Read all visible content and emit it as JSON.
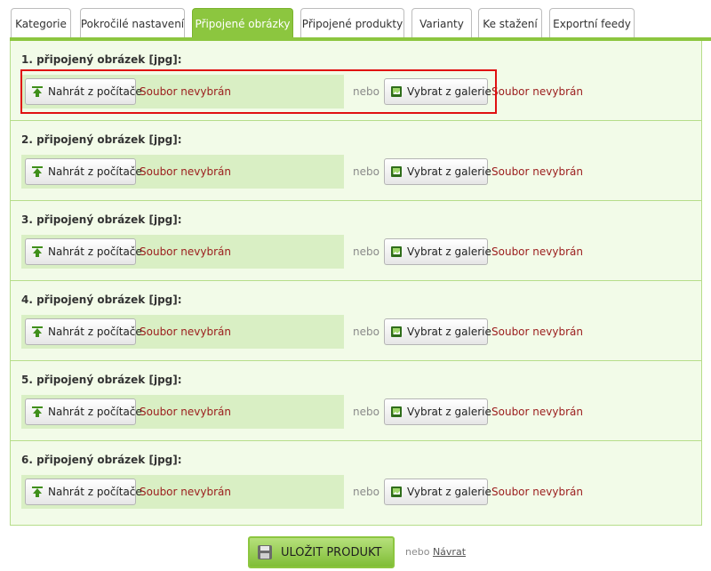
{
  "tabs": [
    {
      "label": "Kategorie",
      "active": false
    },
    {
      "label": "Pokročilé nastavení",
      "active": false
    },
    {
      "label": "Připojené obrázky",
      "active": true
    },
    {
      "label": "Připojené produkty",
      "active": false
    },
    {
      "label": "Varianty",
      "active": false
    },
    {
      "label": "Ke stažení",
      "active": false
    },
    {
      "label": "Exportní feedy",
      "active": false
    }
  ],
  "sections": [
    {
      "title": "1. připojený obrázek [jpg]:",
      "upload_label": "Nahrát z počítače",
      "upload_status": "Soubor nevybrán",
      "or": "nebo",
      "gallery_label": "Vybrat z galerie",
      "gallery_status": "Soubor nevybrán"
    },
    {
      "title": "2. připojený obrázek [jpg]:",
      "upload_label": "Nahrát z počítače",
      "upload_status": "Soubor nevybrán",
      "or": "nebo",
      "gallery_label": "Vybrat z galerie",
      "gallery_status": "Soubor nevybrán"
    },
    {
      "title": "3. připojený obrázek [jpg]:",
      "upload_label": "Nahrát z počítače",
      "upload_status": "Soubor nevybrán",
      "or": "nebo",
      "gallery_label": "Vybrat z galerie",
      "gallery_status": "Soubor nevybrán"
    },
    {
      "title": "4. připojený obrázek [jpg]:",
      "upload_label": "Nahrát z počítače",
      "upload_status": "Soubor nevybrán",
      "or": "nebo",
      "gallery_label": "Vybrat z galerie",
      "gallery_status": "Soubor nevybrán"
    },
    {
      "title": "5. připojený obrázek [jpg]:",
      "upload_label": "Nahrát z počítače",
      "upload_status": "Soubor nevybrán",
      "or": "nebo",
      "gallery_label": "Vybrat z galerie",
      "gallery_status": "Soubor nevybrán"
    },
    {
      "title": "6. připojený obrázek [jpg]:",
      "upload_label": "Nahrát z počítače",
      "upload_status": "Soubor nevybrán",
      "or": "nebo",
      "gallery_label": "Vybrat z galerie",
      "gallery_status": "Soubor nevybrán"
    }
  ],
  "footer": {
    "save_label": "ULOŽIT PRODUKT",
    "or": "nebo",
    "back_label": "Návrat"
  },
  "icons": {
    "upload": "upload-arrow-icon",
    "gallery": "image-gallery-icon",
    "save": "floppy-disk-icon"
  },
  "colors": {
    "accent": "#8cc63f",
    "panel_bg": "#f2fbe8",
    "upload_box_bg": "#d9efc4",
    "status_text": "#9b1c1c",
    "highlight_border": "#e01010"
  }
}
